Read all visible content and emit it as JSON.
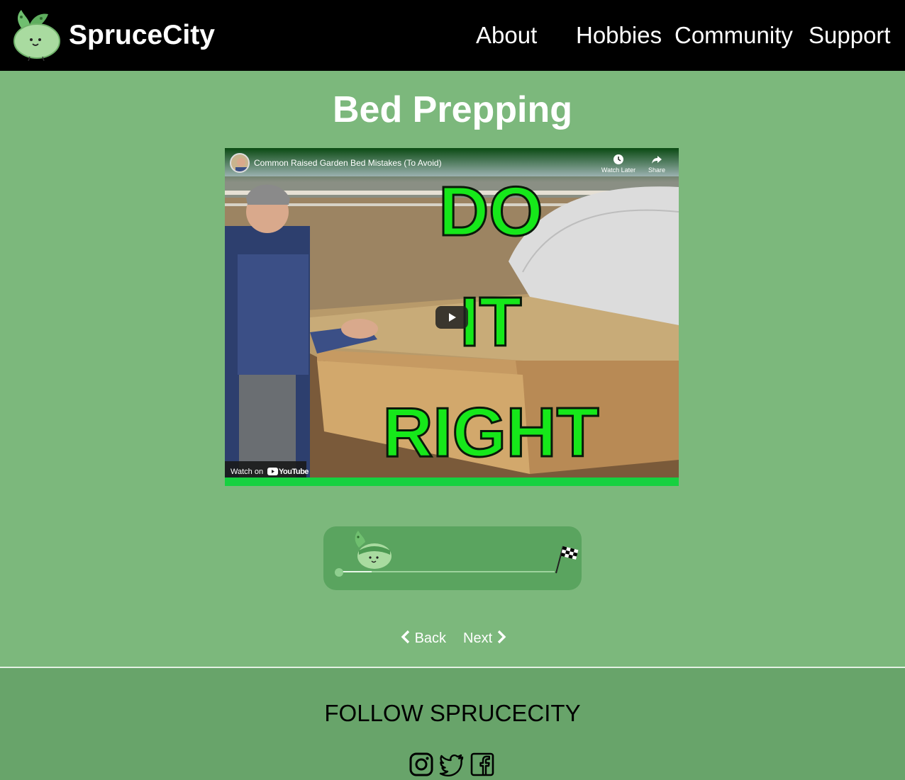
{
  "header": {
    "brand": "SpruceCity",
    "nav": [
      "About",
      "Hobbies",
      "Community",
      "Support"
    ]
  },
  "page": {
    "title": "Bed Prepping"
  },
  "video": {
    "title": "Common Raised Garden Bed Mistakes (To Avoid)",
    "watch_later_label": "Watch Later",
    "share_label": "Share",
    "thumbnail_text": [
      "DO",
      "IT",
      "RIGHT"
    ],
    "watch_on_label": "Watch on",
    "platform_label": "YouTube"
  },
  "progress": {
    "value": 0.15
  },
  "pager": {
    "back_label": "Back",
    "next_label": "Next"
  },
  "footer": {
    "title": "FOLLOW SPRUCECITY",
    "social_icons": [
      "instagram-icon",
      "twitter-icon",
      "facebook-icon"
    ]
  },
  "colors": {
    "header_bg": "#000000",
    "page_bg": "#7cb87c",
    "footer_bg": "#68a46a",
    "thumbnail_text": "#16e81a"
  }
}
